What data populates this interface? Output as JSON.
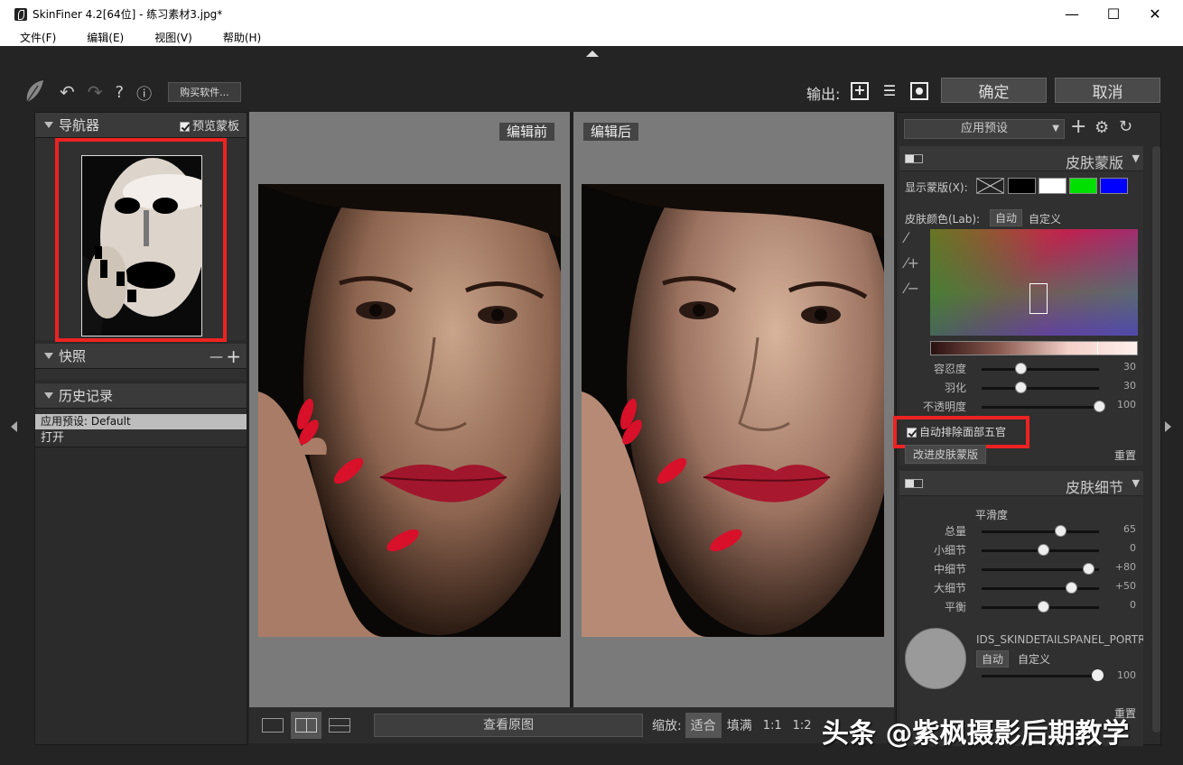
{
  "window": {
    "title": "SkinFiner 4.2[64位] - 练习素材3.jpg*",
    "minimize": "—",
    "maximize": "☐",
    "close": "✕"
  },
  "menu": [
    "文件(F)",
    "编辑(E)",
    "视图(V)",
    "帮助(H)"
  ],
  "toolbar": {
    "buy_label": "购买软件...",
    "output_label": "输出:",
    "ok_label": "确定",
    "cancel_label": "取消"
  },
  "navigator": {
    "title": "导航器",
    "preview_mask_label": "预览蒙板",
    "preview_mask_checked": true
  },
  "snapshot": {
    "title": "快照",
    "minus": "—",
    "plus": "+"
  },
  "history": {
    "title": "历史记录",
    "items": [
      "应用预设: Default",
      "打开"
    ],
    "selected_index": 0
  },
  "view": {
    "before_label": "编辑前",
    "after_label": "编辑后"
  },
  "bottom": {
    "view_original_label": "查看原图",
    "zoom_label": "缩放:",
    "fit_label": "适合",
    "fill_label": "填满",
    "ratio1": "1:1",
    "ratio2": "1:2"
  },
  "watermark": "头条 @紫枫摄影后期教学",
  "preset": {
    "label": "应用预设"
  },
  "skin_mask": {
    "title": "皮肤蒙版",
    "display_label": "显示蒙版(X):",
    "color_label": "皮肤颜色(Lab):",
    "auto_label": "自动",
    "custom_label": "自定义",
    "sliders": [
      {
        "label": "容忍度",
        "value": 30,
        "pos": 0.3
      },
      {
        "label": "羽化",
        "value": 30,
        "pos": 0.3
      },
      {
        "label": "不透明度",
        "value": 100,
        "pos": 1.0
      }
    ],
    "auto_exclude_label": "自动排除面部五官",
    "auto_exclude_checked": true,
    "improve_label": "改进皮肤蒙版",
    "reset_label": "重置"
  },
  "skin_detail": {
    "title": "皮肤细节",
    "smooth_label": "平滑度",
    "sliders": [
      {
        "label": "总量",
        "value": "65",
        "pos": 0.65
      },
      {
        "label": "小细节",
        "value": "0",
        "pos": 0.5
      },
      {
        "label": "中细节",
        "value": "+80",
        "pos": 0.9
      },
      {
        "label": "大细节",
        "value": "+50",
        "pos": 0.75
      },
      {
        "label": "平衡",
        "value": "0",
        "pos": 0.5
      }
    ],
    "portrait_label": "IDS_SKINDETAILSPANEL_PORTR",
    "auto_label": "自动",
    "custom_label": "自定义",
    "portrait_value": 100,
    "reset_label": "重置"
  },
  "colors": {
    "accent_red": "#ee2222",
    "mask_green": "#00e000",
    "mask_blue": "#0000ff"
  }
}
